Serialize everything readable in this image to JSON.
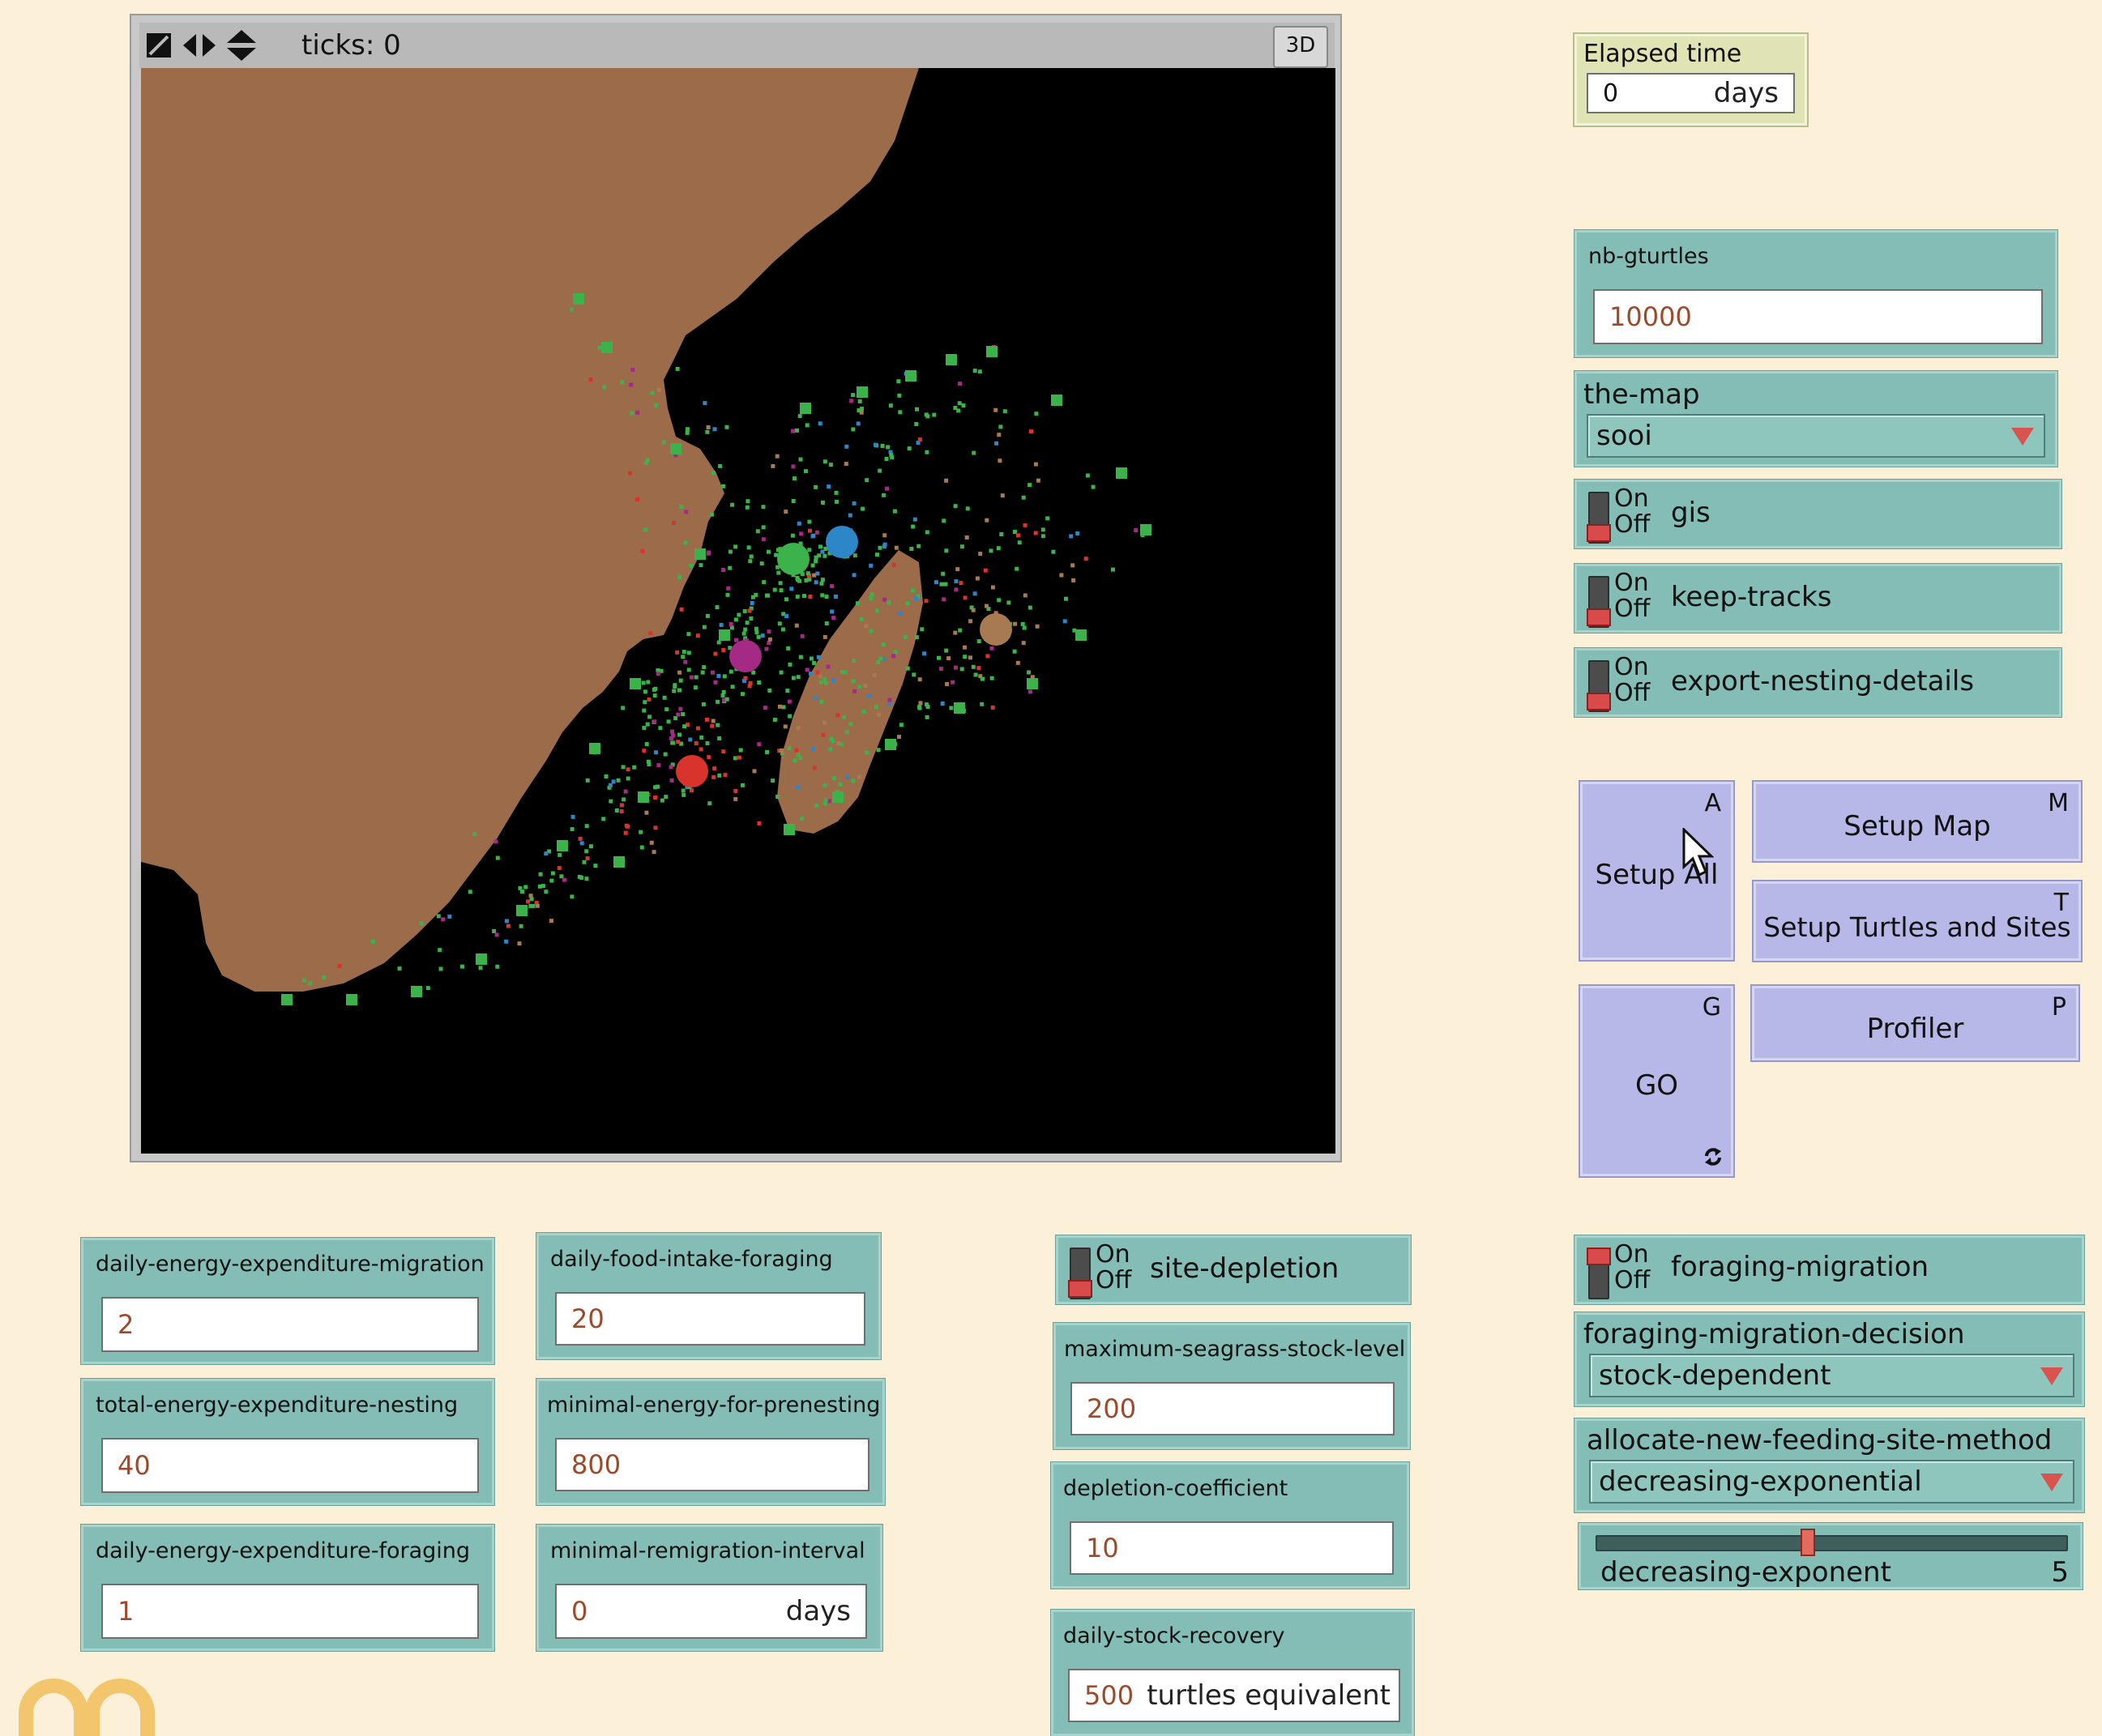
{
  "view": {
    "ticks_label": "ticks: 0",
    "btn_3d": "3D"
  },
  "monitor": {
    "label": "Elapsed time",
    "value": "0",
    "unit": "days"
  },
  "nb_gturtles": {
    "label": "nb-gturtles",
    "value": "10000"
  },
  "the_map": {
    "label": "the-map",
    "value": "sooi"
  },
  "switches": {
    "gis": {
      "label": "gis",
      "on": "On",
      "off": "Off"
    },
    "keep_tracks": {
      "label": "keep-tracks",
      "on": "On",
      "off": "Off"
    },
    "export_nesting": {
      "label": "export-nesting-details",
      "on": "On",
      "off": "Off"
    },
    "site_depletion": {
      "label": "site-depletion",
      "on": "On",
      "off": "Off"
    },
    "foraging_migration": {
      "label": "foraging-migration",
      "on": "On",
      "off": "Off"
    }
  },
  "buttons": {
    "setup_all": {
      "label": "Setup All",
      "key": "A"
    },
    "setup_map": {
      "label": "Setup Map",
      "key": "M"
    },
    "setup_turtles": {
      "label": "Setup Turtles and Sites",
      "key": "T"
    },
    "go": {
      "label": "GO",
      "key": "G"
    },
    "profiler": {
      "label": "Profiler",
      "key": "P"
    }
  },
  "inputs": {
    "daily_energy_migration": {
      "label": "daily-energy-expenditure-migration",
      "value": "2"
    },
    "total_energy_nesting": {
      "label": "total-energy-expenditure-nesting",
      "value": "40"
    },
    "daily_energy_foraging": {
      "label": "daily-energy-expenditure-foraging",
      "value": "1"
    },
    "daily_food_intake": {
      "label": "daily-food-intake-foraging",
      "value": "20"
    },
    "minimal_energy_prenesting": {
      "label": "minimal-energy-for-prenesting",
      "value": "800"
    },
    "minimal_remigration": {
      "label": "minimal-remigration-interval",
      "value": "0",
      "unit": "days"
    },
    "max_seagrass": {
      "label": "maximum-seagrass-stock-level",
      "value": "200"
    },
    "depletion_coefficient": {
      "label": "depletion-coefficient",
      "value": "10"
    },
    "daily_stock_recovery": {
      "label": "daily-stock-recovery",
      "value": "500",
      "unit": "turtles equivalent"
    }
  },
  "choosers": {
    "foraging_decision": {
      "label": "foraging-migration-decision",
      "value": "stock-dependent"
    },
    "allocate_method": {
      "label": "allocate-new-feeding-site-method",
      "value": "decreasing-exponential"
    }
  },
  "slider": {
    "label": "decreasing-exponent",
    "value": "5",
    "fraction": 0.45
  },
  "colors": {
    "land": "#9b6b4a",
    "sea": "#000000",
    "site_green": "#3cb24a",
    "site_blue": "#2d86c8",
    "site_magenta": "#a42a86",
    "site_red": "#d9342b",
    "site_brown": "#a87a52"
  }
}
